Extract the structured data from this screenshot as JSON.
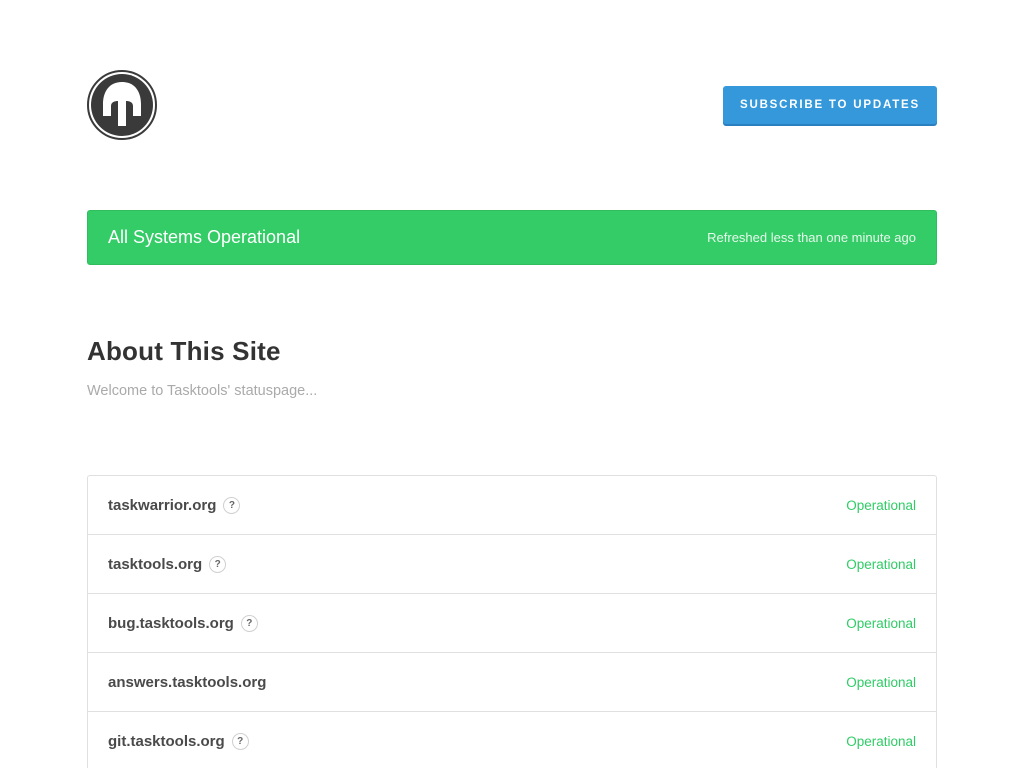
{
  "header": {
    "logo_icon": "spartan-helmet-icon",
    "subscribe_label": "Subscribe to Updates"
  },
  "status": {
    "message": "All Systems Operational",
    "refreshed": "Refreshed less than one minute ago",
    "color": "#33cc66"
  },
  "about": {
    "title": "About This Site",
    "description": "Welcome to Tasktools' statuspage..."
  },
  "components": [
    {
      "name": "taskwarrior.org",
      "status": "Operational",
      "has_help": true
    },
    {
      "name": "tasktools.org",
      "status": "Operational",
      "has_help": true
    },
    {
      "name": "bug.tasktools.org",
      "status": "Operational",
      "has_help": true
    },
    {
      "name": "answers.tasktools.org",
      "status": "Operational",
      "has_help": false
    },
    {
      "name": "git.tasktools.org",
      "status": "Operational",
      "has_help": true
    }
  ],
  "help_glyph": "?",
  "colors": {
    "accent": "#3498db",
    "operational": "#2fcc66"
  }
}
